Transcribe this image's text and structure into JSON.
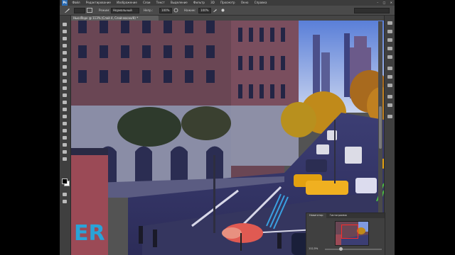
{
  "menubar": {
    "logo": "Ps",
    "items": [
      "Файл",
      "Редактирование",
      "Изображение",
      "Слои",
      "Текст",
      "Выделение",
      "Фильтр",
      "3D",
      "Просмотр",
      "Окно",
      "Справка"
    ],
    "controls": [
      "–",
      "□",
      "✕"
    ]
  },
  "options": {
    "mode_label": "Режим:",
    "mode_value": "Нормальный",
    "opacity_label": "Непр.:",
    "opacity_value": "100%",
    "pressure_label": "Нажим:",
    "pressure_value": "100%"
  },
  "document": {
    "tab_label": "Нью-Йорк @ 113% (Слой 4, Слой-маска/8) *"
  },
  "scene": {
    "storefront_letters": "ER"
  },
  "navigator": {
    "tabs": [
      "Навигатор",
      "Гистограмма"
    ],
    "zoom": "112,5%"
  }
}
